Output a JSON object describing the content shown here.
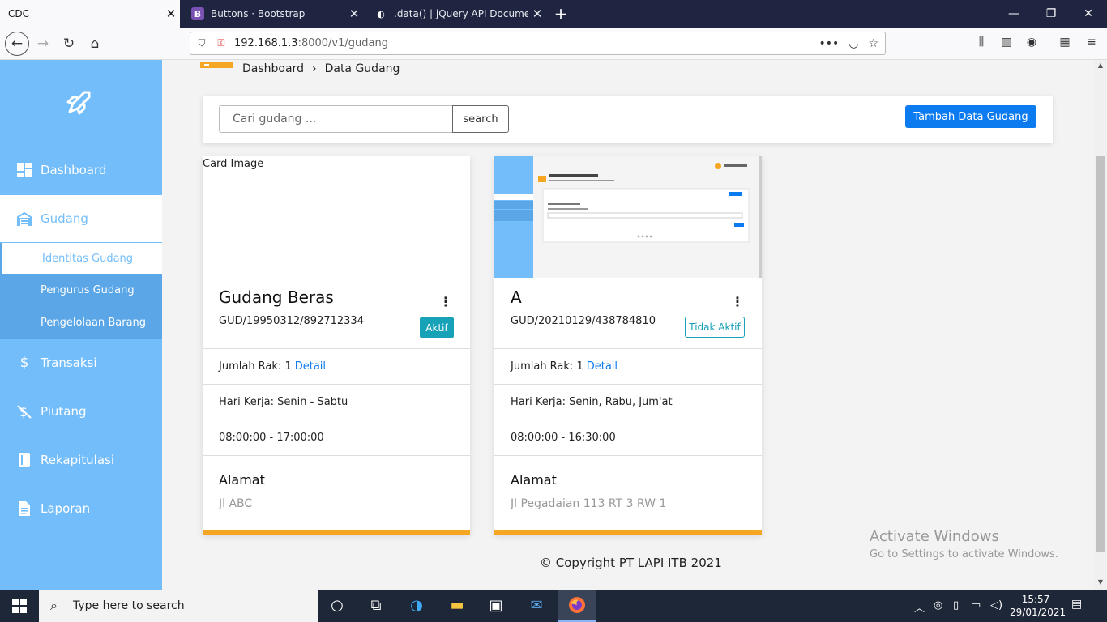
{
  "browser": {
    "tabs": [
      {
        "title": "CDC",
        "favicon": ""
      },
      {
        "title": "Buttons · Bootstrap",
        "favicon": "B"
      },
      {
        "title": ".data() | jQuery API Documenta",
        "favicon": "jquery-icon"
      }
    ],
    "url_host": "192.168.1.3",
    "url_rest": ":8000/v1/gudang"
  },
  "sidebar": {
    "items": [
      {
        "label": "Dashboard",
        "icon": "dashboard-icon"
      },
      {
        "label": "Gudang",
        "icon": "warehouse-icon"
      },
      {
        "label": "Transaksi",
        "icon": "dollar-icon"
      },
      {
        "label": "Piutang",
        "icon": "dollar-slash-icon"
      },
      {
        "label": "Rekapitulasi",
        "icon": "book-icon"
      },
      {
        "label": "Laporan",
        "icon": "file-icon"
      }
    ],
    "sub_items": [
      {
        "label": "Identitas Gudang"
      },
      {
        "label": "Pengurus Gudang"
      },
      {
        "label": "Pengelolaan Barang"
      }
    ]
  },
  "breadcrumb": {
    "home": "Dashboard",
    "separator": "›",
    "current": "Data Gudang"
  },
  "toolbar": {
    "search_placeholder": "Cari gudang ...",
    "search_label": "search",
    "add_label": "Tambah Data Gudang"
  },
  "cards": [
    {
      "image_alt": "Card Image",
      "title": "Gudang Beras",
      "code": "GUD/19950312/892712334",
      "status": "Aktif",
      "rak_label": "Jumlah Rak: 1",
      "rak_link": "Detail",
      "hari_kerja": "Hari Kerja: Senin - Sabtu",
      "jam": "08:00:00 - 17:00:00",
      "alamat_label": "Alamat",
      "alamat": "Jl ABC"
    },
    {
      "image_alt": "",
      "title": "A",
      "code": "GUD/20210129/438784810",
      "status": "Tidak Aktif",
      "rak_label": "Jumlah Rak: 1",
      "rak_link": "Detail",
      "hari_kerja": "Hari Kerja: Senin, Rabu, Jum'at",
      "jam": "08:00:00 - 16:30:00",
      "alamat_label": "Alamat",
      "alamat": "Jl Pegadaian 113 RT 3 RW 1"
    }
  ],
  "footer": {
    "copyright": "© Copyright PT LAPI ITB 2021"
  },
  "watermark": {
    "title": "Activate Windows",
    "subtitle": "Go to Settings to activate Windows."
  },
  "taskbar": {
    "search_placeholder": "Type here to search",
    "time": "15:57",
    "date": "29/01/2021"
  },
  "colors": {
    "sidebar": "#74bdfb",
    "accent": "#f5a623",
    "primary": "#0d7bf0",
    "info": "#17a2b8"
  }
}
